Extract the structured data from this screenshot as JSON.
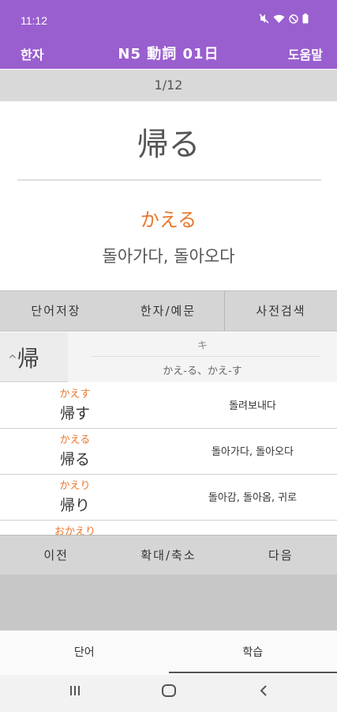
{
  "status": {
    "time": "11:12",
    "icons": [
      "mute-icon",
      "wifi-icon",
      "dnd-icon",
      "battery-icon"
    ]
  },
  "header": {
    "left_label": "한자",
    "title": "N5  動詞  01日",
    "right_label": "도움말",
    "color": "#9a5fcf"
  },
  "counter": "1/12",
  "card": {
    "word": "帰る",
    "reading": "かえる",
    "meaning": "돌아가다, 돌아오다",
    "reading_color": "#e8762b"
  },
  "tabs": [
    "단어저장",
    "한자/예문",
    "사전검색"
  ],
  "kanji": {
    "char": "帰",
    "caret": "^",
    "on": "キ",
    "kun": "かえ-る、かえ-す"
  },
  "words": [
    {
      "furigana": "かえす",
      "kanji": "帰す",
      "meaning": "돌려보내다"
    },
    {
      "furigana": "かえる",
      "kanji": "帰る",
      "meaning": "돌아가다, 돌아오다"
    },
    {
      "furigana": "かえり",
      "kanji": "帰り",
      "meaning": "돌아감, 돌아옴, 귀로"
    },
    {
      "furigana": "おかえり",
      "kanji": "",
      "meaning": ""
    }
  ],
  "nav": [
    "이전",
    "확대/축소",
    "다음"
  ],
  "bottom_tabs": [
    "단어",
    "학습"
  ]
}
